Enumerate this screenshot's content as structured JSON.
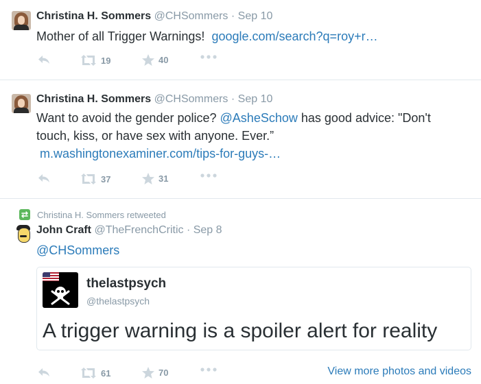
{
  "tweets": [
    {
      "name": "Christina H. Sommers",
      "handle": "@CHSommers",
      "dot": "·",
      "date": "Sep 10",
      "text": "Mother of all Trigger Warnings!",
      "link": "google.com/search?q=roy+r…",
      "retweets": "19",
      "favorites": "40"
    },
    {
      "name": "Christina H. Sommers",
      "handle": "@CHSommers",
      "dot": "·",
      "date": "Sep 10",
      "text_before": "Want to avoid the gender police?",
      "mention": "@AsheSchow",
      "text_after": "has good advice: \"Don't touch, kiss, or have sex with anyone. Ever.”",
      "link": "m.washingtonexaminer.com/tips-for-guys-…",
      "retweets": "37",
      "favorites": "31"
    },
    {
      "retweet_context": "Christina H. Sommers retweeted",
      "name": "John Craft",
      "handle": "@TheFrenchCritic",
      "dot": "·",
      "date": "Sep 8",
      "mention": "@CHSommers",
      "card": {
        "name": "thelastpsych",
        "handle": "@thelastpsych",
        "text": "A trigger warning is a spoiler alert for reality"
      },
      "retweets": "61",
      "favorites": "70",
      "view_more": "View more photos and videos"
    }
  ],
  "icons": {
    "reply": "reply-icon",
    "retweet": "retweet-icon",
    "favorite": "star-icon",
    "more": "more-icon",
    "skull": "skull-crossbones-icon"
  },
  "colors": {
    "link": "#2b7bb9",
    "muted": "#8899a6",
    "text": "#292f33",
    "retweet_badge": "#5cb85c"
  }
}
